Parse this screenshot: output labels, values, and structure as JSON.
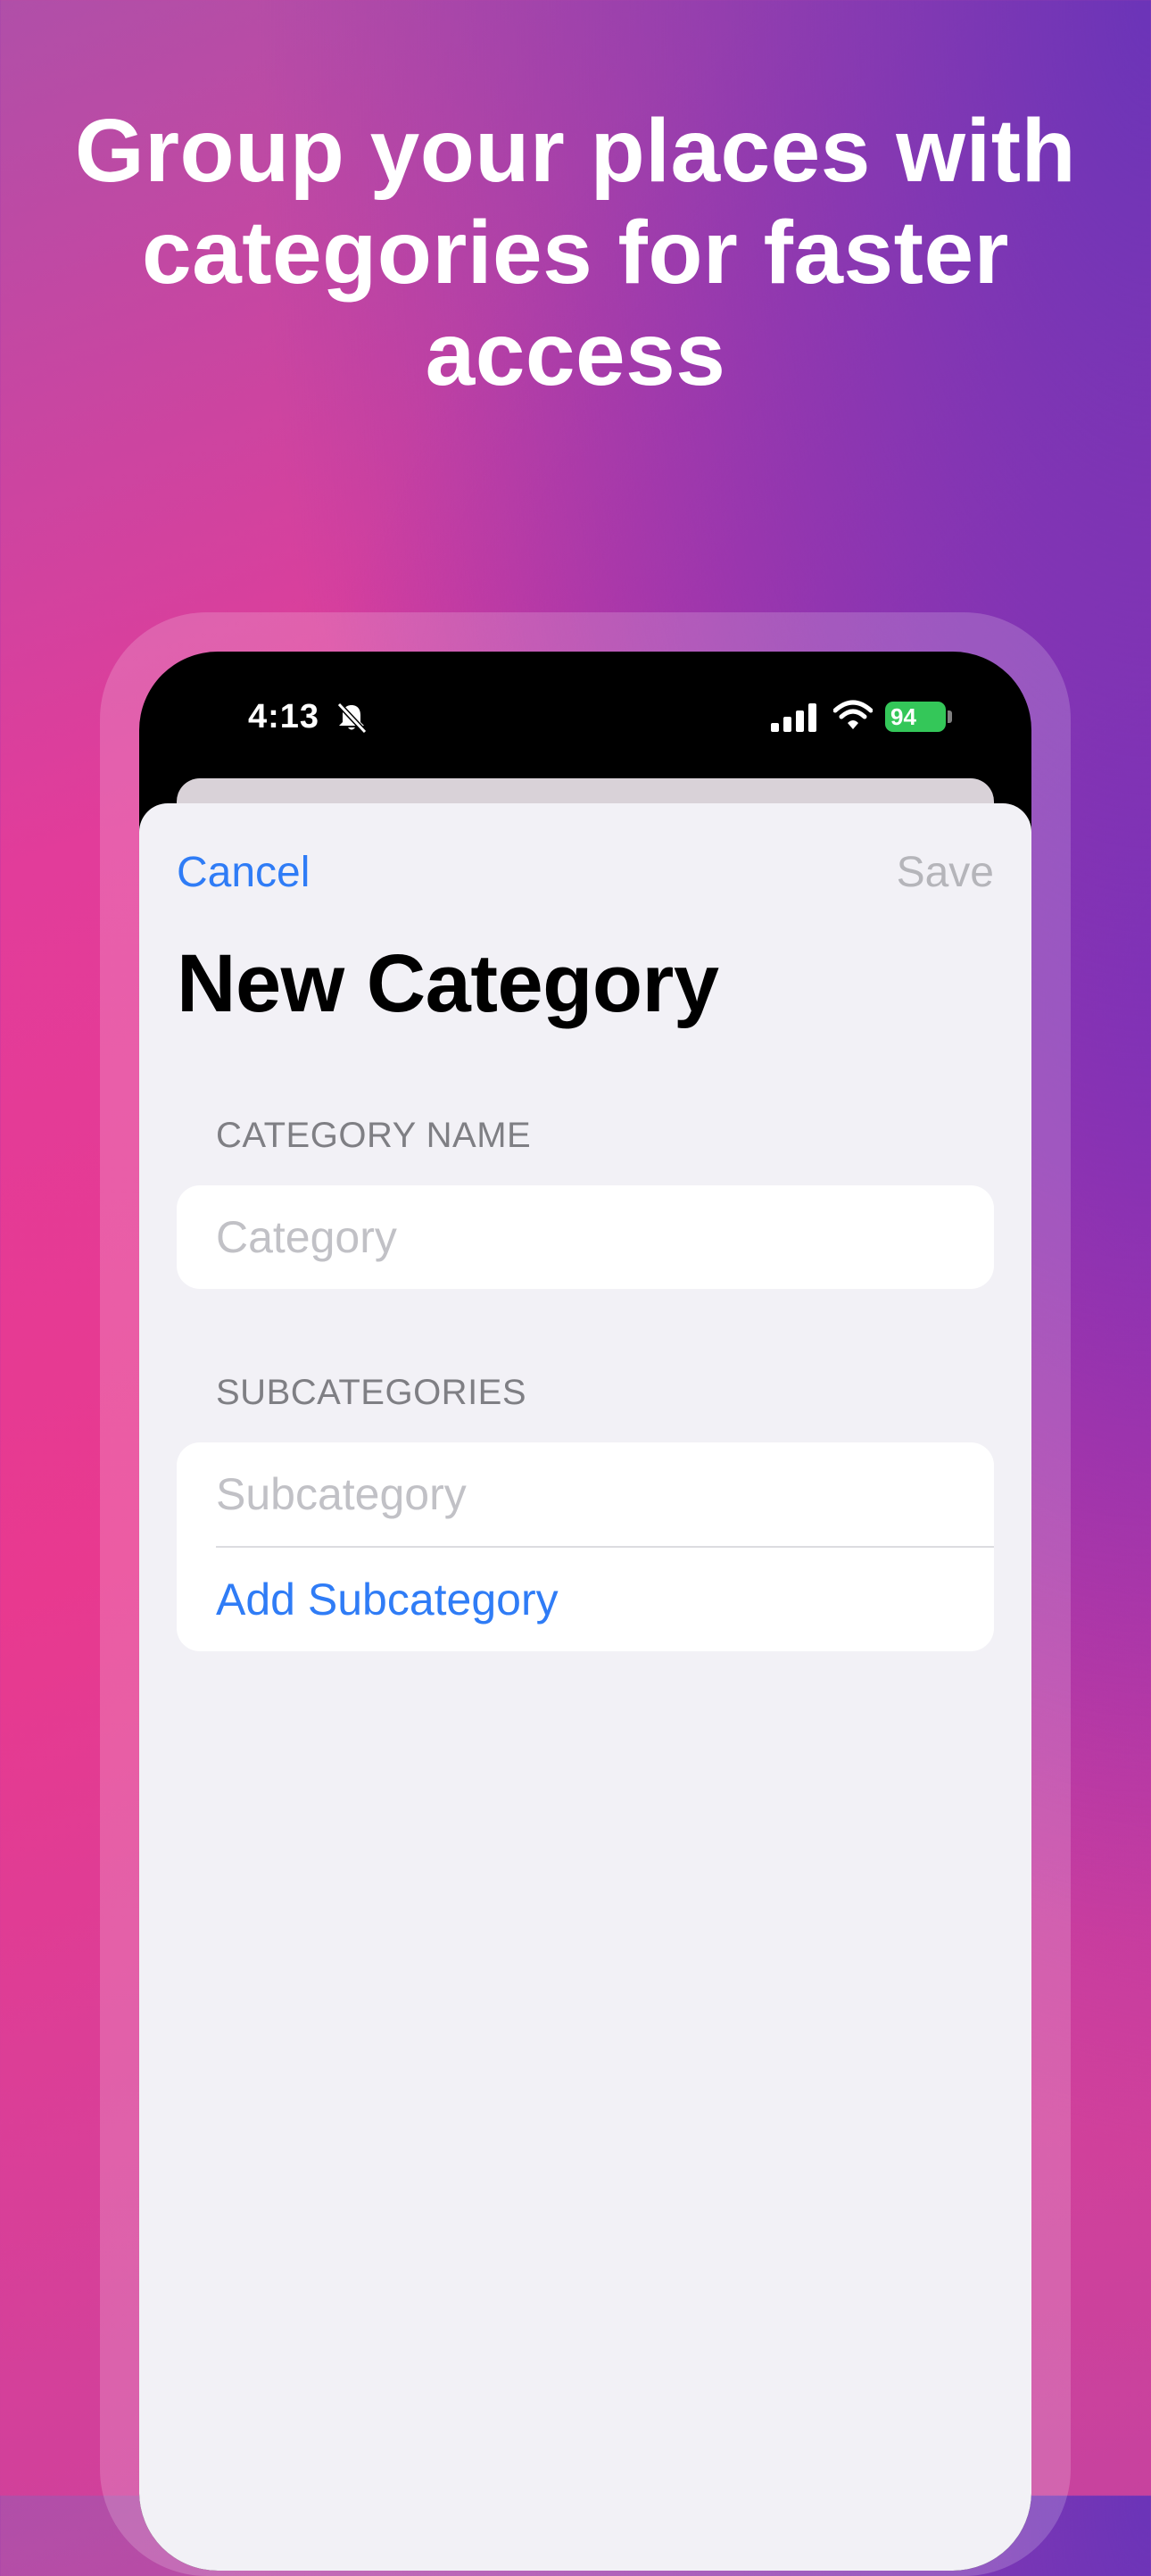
{
  "promo": {
    "headline": "Group your places with categories for faster access"
  },
  "status_bar": {
    "time": "4:13",
    "bell_icon": "bell-slash-icon",
    "signal_icon": "cellular-signal-icon",
    "wifi_icon": "wifi-icon",
    "battery_level": "94"
  },
  "nav": {
    "cancel_label": "Cancel",
    "save_label": "Save"
  },
  "form": {
    "title": "New Category",
    "category_name": {
      "section_label": "CATEGORY NAME",
      "placeholder": "Category",
      "value": ""
    },
    "subcategories": {
      "section_label": "SUBCATEGORIES",
      "placeholder": "Subcategory",
      "value": "",
      "add_label": "Add Subcategory"
    }
  },
  "colors": {
    "accent": "#2f7cf6",
    "disabled": "#b5b5ba",
    "battery": "#34c759",
    "sheet_background": "#f2f1f6"
  }
}
